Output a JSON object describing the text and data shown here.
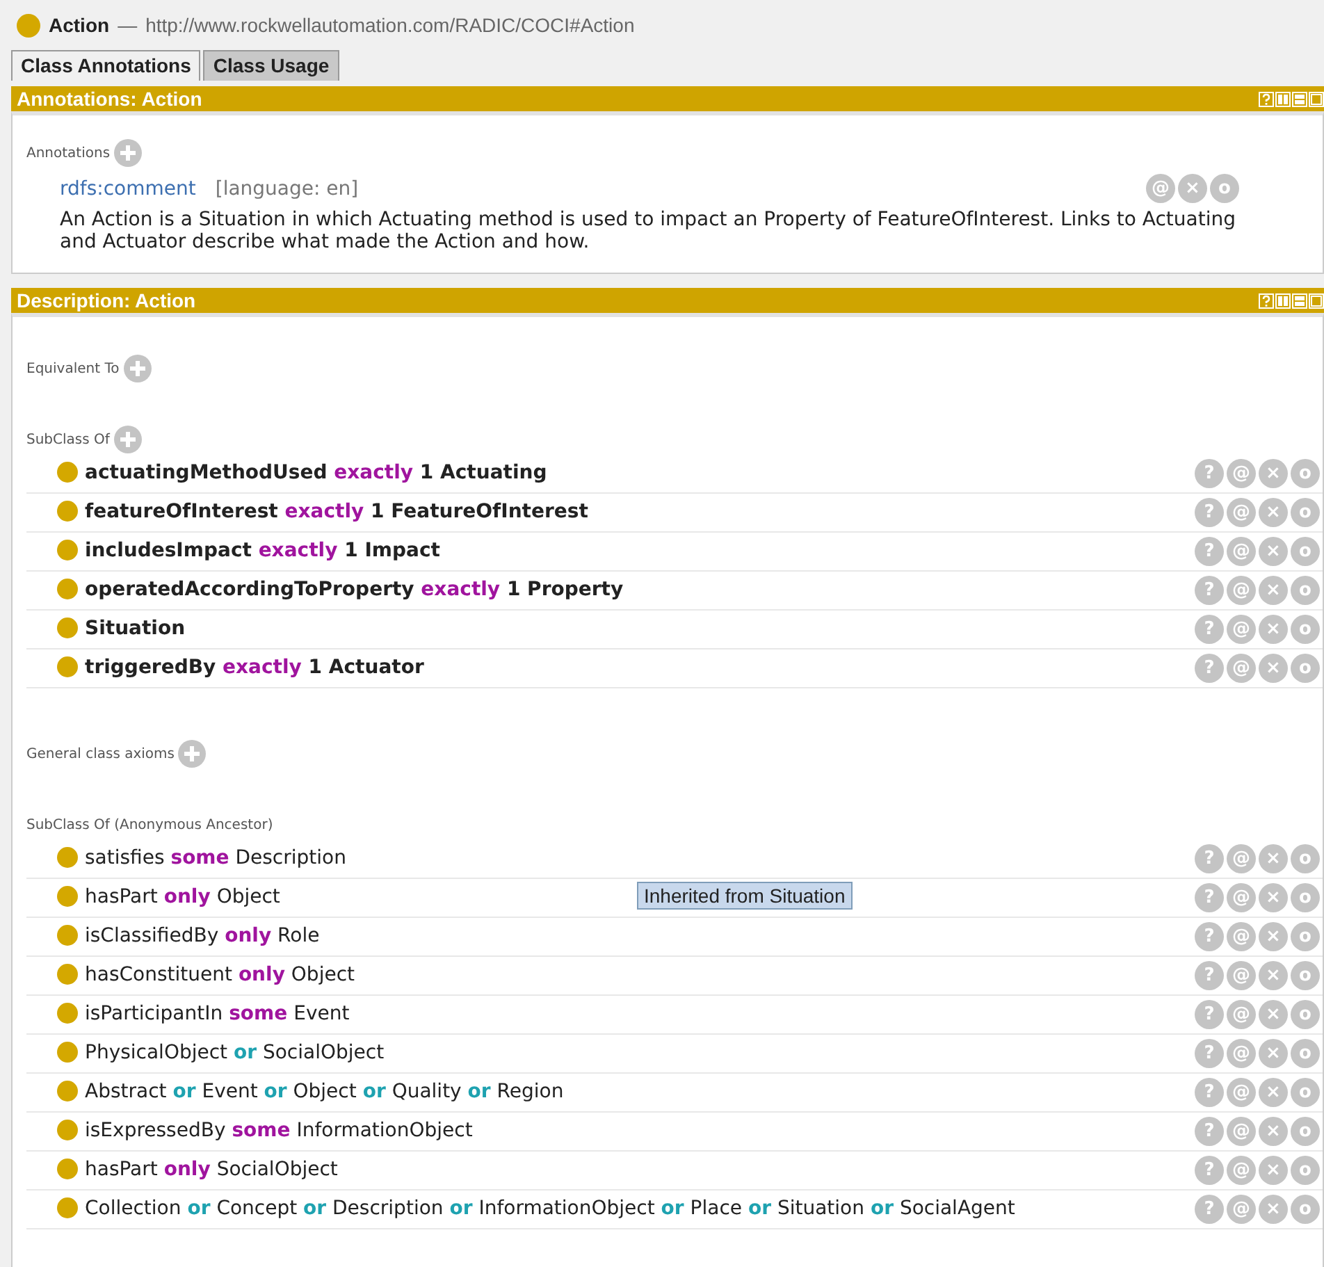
{
  "window": {
    "title": "Action",
    "separator": "—",
    "iri": "http://www.rockwellautomation.com/RADIC/COCI#Action"
  },
  "tabs": [
    {
      "label": "Class Annotations",
      "selected": true
    },
    {
      "label": "Class Usage",
      "selected": false
    }
  ],
  "annotations_panel": {
    "title": "Annotations: Action",
    "section_label": "Annotations",
    "annotations": [
      {
        "property": "rdfs:comment",
        "language": "[language: en]",
        "text": "An Action is a Situation in which Actuating method is used to impact an Property of FeatureOfInterest. Links to Actuating and Actuator describe what made the Action and how.",
        "buttons": [
          "@",
          "×",
          "o"
        ]
      }
    ]
  },
  "description_panel": {
    "title": "Description: Action",
    "sections": [
      {
        "label": "Equivalent To",
        "addable": true
      },
      {
        "label": "SubClass Of",
        "addable": true,
        "items": [
          {
            "asserted": true,
            "parts": [
              {
                "kind": "entity",
                "text": "actuatingMethodUsed"
              },
              {
                "kind": "restriction",
                "text": "exactly"
              },
              {
                "kind": "entity",
                "text": "1 Actuating"
              }
            ],
            "buttons": [
              "?",
              "@",
              "×",
              "o"
            ]
          },
          {
            "asserted": true,
            "parts": [
              {
                "kind": "entity",
                "text": "featureOfInterest"
              },
              {
                "kind": "restriction",
                "text": "exactly"
              },
              {
                "kind": "entity",
                "text": "1 FeatureOfInterest"
              }
            ],
            "buttons": [
              "?",
              "@",
              "×",
              "o"
            ]
          },
          {
            "asserted": true,
            "parts": [
              {
                "kind": "entity",
                "text": "includesImpact"
              },
              {
                "kind": "restriction",
                "text": "exactly"
              },
              {
                "kind": "entity",
                "text": "1 Impact"
              }
            ],
            "buttons": [
              "?",
              "@",
              "×",
              "o"
            ]
          },
          {
            "asserted": true,
            "parts": [
              {
                "kind": "entity",
                "text": "operatedAccordingToProperty"
              },
              {
                "kind": "restriction",
                "text": "exactly"
              },
              {
                "kind": "entity",
                "text": "1 Property"
              }
            ],
            "buttons": [
              "?",
              "@",
              "×",
              "o"
            ]
          },
          {
            "asserted": true,
            "parts": [
              {
                "kind": "entity",
                "text": "Situation"
              }
            ],
            "buttons": [
              "?",
              "@",
              "×",
              "o"
            ]
          },
          {
            "asserted": true,
            "parts": [
              {
                "kind": "entity",
                "text": "triggeredBy"
              },
              {
                "kind": "restriction",
                "text": "exactly"
              },
              {
                "kind": "entity",
                "text": "1 Actuator"
              }
            ],
            "buttons": [
              "?",
              "@",
              "×",
              "o"
            ]
          }
        ]
      },
      {
        "label": "General class axioms",
        "addable": true
      },
      {
        "label": "SubClass Of (Anonymous Ancestor)",
        "items": [
          {
            "asserted": false,
            "parts": [
              {
                "kind": "entity",
                "text": "satisfies"
              },
              {
                "kind": "restriction",
                "text": "some"
              },
              {
                "kind": "entity",
                "text": "Description"
              }
            ],
            "buttons": [
              "?",
              "@",
              "×",
              "o"
            ]
          },
          {
            "asserted": false,
            "parts": [
              {
                "kind": "entity",
                "text": "hasPart"
              },
              {
                "kind": "restriction",
                "text": "only"
              },
              {
                "kind": "entity",
                "text": "Object"
              }
            ],
            "buttons": [
              "?",
              "@",
              "×",
              "o"
            ],
            "tooltip": "Inherited from Situation"
          },
          {
            "asserted": false,
            "parts": [
              {
                "kind": "entity",
                "text": "isClassifiedBy"
              },
              {
                "kind": "restriction",
                "text": "only"
              },
              {
                "kind": "entity",
                "text": "Role"
              }
            ],
            "buttons": [
              "?",
              "@",
              "×",
              "o"
            ]
          },
          {
            "asserted": false,
            "parts": [
              {
                "kind": "entity",
                "text": "hasConstituent"
              },
              {
                "kind": "restriction",
                "text": "only"
              },
              {
                "kind": "entity",
                "text": "Object"
              }
            ],
            "buttons": [
              "?",
              "@",
              "×",
              "o"
            ]
          },
          {
            "asserted": false,
            "parts": [
              {
                "kind": "entity",
                "text": "isParticipantIn"
              },
              {
                "kind": "restriction",
                "text": "some"
              },
              {
                "kind": "entity",
                "text": "Event"
              }
            ],
            "buttons": [
              "?",
              "@",
              "×",
              "o"
            ]
          },
          {
            "asserted": false,
            "parts": [
              {
                "kind": "entity",
                "text": "PhysicalObject"
              },
              {
                "kind": "connective",
                "text": "or"
              },
              {
                "kind": "entity",
                "text": "SocialObject"
              }
            ],
            "buttons": [
              "?",
              "@",
              "×",
              "o"
            ]
          },
          {
            "asserted": false,
            "parts": [
              {
                "kind": "entity",
                "text": "Abstract"
              },
              {
                "kind": "connective",
                "text": "or"
              },
              {
                "kind": "entity",
                "text": "Event"
              },
              {
                "kind": "connective",
                "text": "or"
              },
              {
                "kind": "entity",
                "text": "Object"
              },
              {
                "kind": "connective",
                "text": "or"
              },
              {
                "kind": "entity",
                "text": "Quality"
              },
              {
                "kind": "connective",
                "text": "or"
              },
              {
                "kind": "entity",
                "text": "Region"
              }
            ],
            "buttons": [
              "?",
              "@",
              "×",
              "o"
            ]
          },
          {
            "asserted": false,
            "parts": [
              {
                "kind": "entity",
                "text": "isExpressedBy"
              },
              {
                "kind": "restriction",
                "text": "some"
              },
              {
                "kind": "entity",
                "text": "InformationObject"
              }
            ],
            "buttons": [
              "?",
              "@",
              "×",
              "o"
            ]
          },
          {
            "asserted": false,
            "parts": [
              {
                "kind": "entity",
                "text": "hasPart"
              },
              {
                "kind": "restriction",
                "text": "only"
              },
              {
                "kind": "entity",
                "text": "SocialObject"
              }
            ],
            "buttons": [
              "?",
              "@",
              "×",
              "o"
            ]
          },
          {
            "asserted": false,
            "parts": [
              {
                "kind": "entity",
                "text": "Collection"
              },
              {
                "kind": "connective",
                "text": "or"
              },
              {
                "kind": "entity",
                "text": "Concept"
              },
              {
                "kind": "connective",
                "text": "or"
              },
              {
                "kind": "entity",
                "text": "Description"
              },
              {
                "kind": "connective",
                "text": "or"
              },
              {
                "kind": "entity",
                "text": "InformationObject"
              },
              {
                "kind": "connective",
                "text": "or"
              },
              {
                "kind": "entity",
                "text": "Place"
              },
              {
                "kind": "connective",
                "text": "or"
              },
              {
                "kind": "entity",
                "text": "Situation"
              },
              {
                "kind": "connective",
                "text": "or"
              },
              {
                "kind": "entity",
                "text": "SocialAgent"
              }
            ],
            "buttons": [
              "?",
              "@",
              "×",
              "o"
            ]
          }
        ]
      }
    ]
  }
}
